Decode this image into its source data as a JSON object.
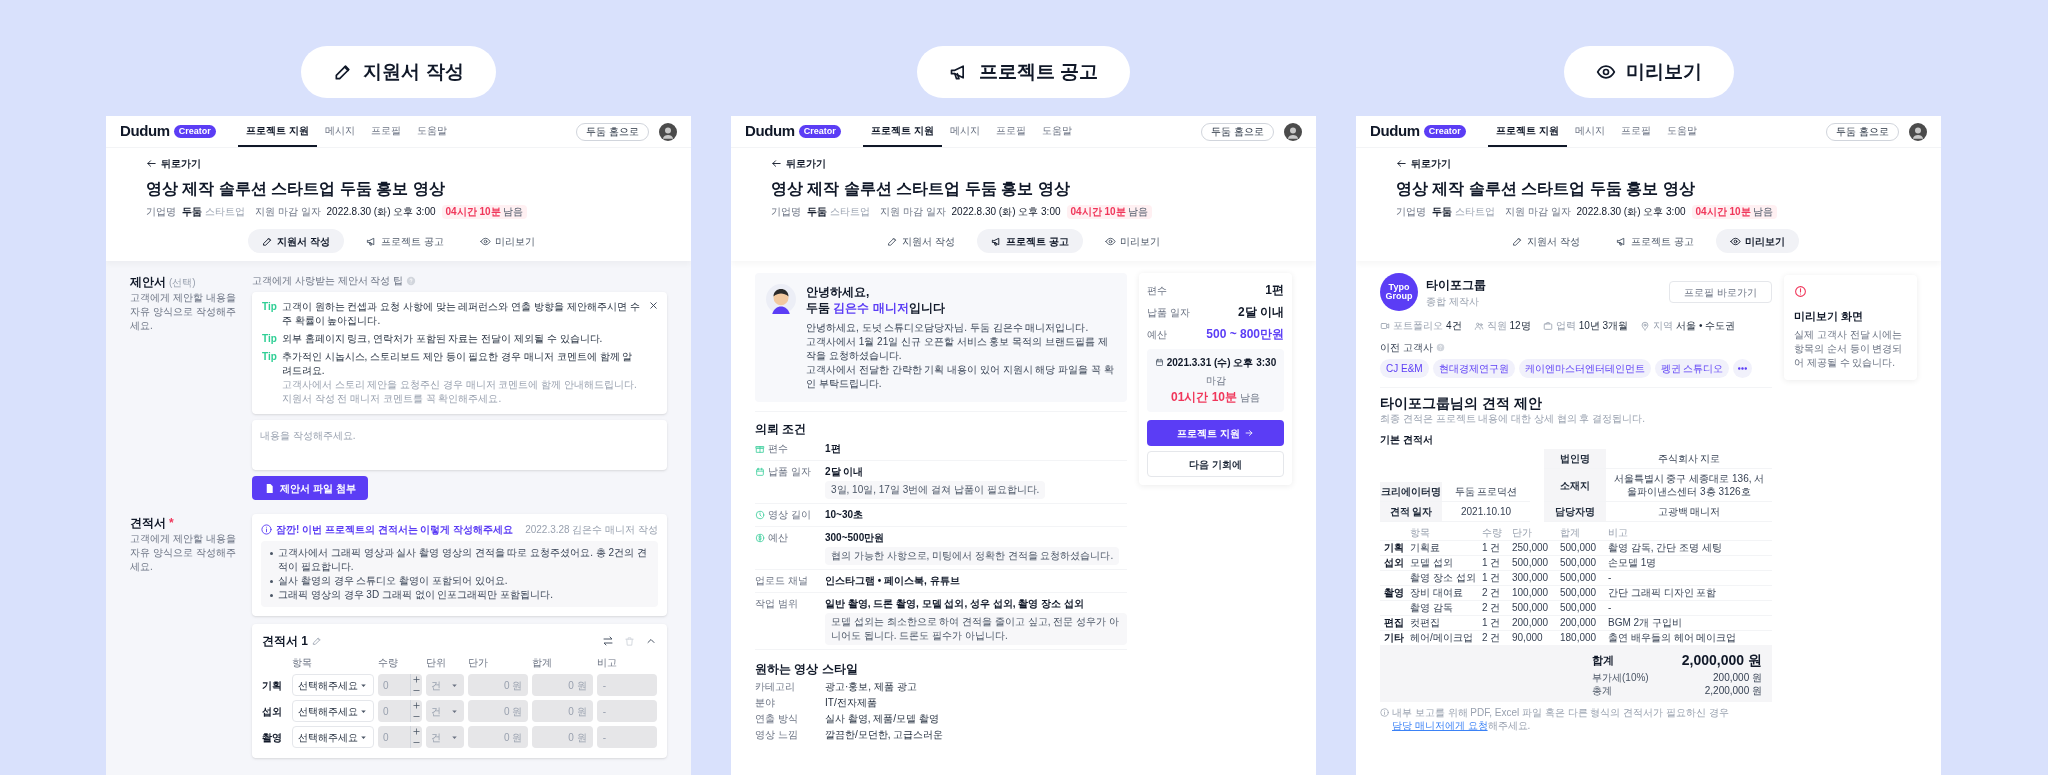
{
  "steps": [
    {
      "label": "지원서 작성"
    },
    {
      "label": "프로젝트 공고"
    },
    {
      "label": "미리보기"
    }
  ],
  "screens": [
    {
      "nav": {
        "logo": "Dudum",
        "badge": "Creator",
        "items": [
          {
            "label": "프로젝트 지원",
            "selected": true
          },
          {
            "label": "메시지",
            "selected": false
          },
          {
            "label": "프로필",
            "selected": false
          },
          {
            "label": "도움말",
            "selected": false
          }
        ],
        "home_button": "두둠 홈으로"
      },
      "back": "뒤로가기",
      "title": "영상 제작 솔루션 스타트업 두둠 홍보 영상",
      "meta": {
        "company_label": "기업명",
        "company": "두둠",
        "company_type": "스타트업",
        "deadline_label": "지원 마감 일자",
        "deadline": "2022.8.30 (화) 오후 3:00",
        "remaining": "04시간 10분",
        "remaining_suffix": "남음"
      },
      "tabs": [
        {
          "label": "지원서 작성",
          "selected": true
        },
        {
          "label": "프로젝트 공고",
          "selected": false
        },
        {
          "label": "미리보기",
          "selected": false
        }
      ],
      "body": {
        "kind": "application",
        "proposal": {
          "title": "제안서",
          "tag": "(선택)",
          "desc": [
            "고객에게 제안할 내용을",
            "자유 양식으로 작성해주세요."
          ],
          "tip_heading": "고객에게 사랑받는 제안서 작성 팁",
          "tips": [
            {
              "label": "Tip",
              "text": "고객이 원하는 컨셉과 요청 사항에 맞는 레퍼런스와 연출 방향을 제안해주시면 수주 확률이 높아집니다."
            },
            {
              "label": "Tip",
              "text": "외부 홈페이지 링크, 연락처가 포함된 자료는 전달이 제외될 수 있습니다."
            },
            {
              "label": "Tip",
              "text": "추가적인 시놉시스, 스토리보드 제안 등이 필요한 경우 매니저 코멘트에 함께 알려드려요.",
              "note": "고객사에서 스토리 제안을 요청주신 경우 매니저 코멘트에 함께 안내해드립니다. 지원서 작성 전 매니저 코멘트를 꼭 확인해주세요."
            }
          ],
          "placeholder": "내용을 작성해주세요.",
          "attach_button": "제안서 파일 첨부"
        },
        "estimate": {
          "title": "견적서",
          "required": "*",
          "desc": [
            "고객에게 제안할 내용을",
            "자유 양식으로 작성해주세요."
          ],
          "notice": {
            "title": "잠깐! 이번 프로젝트의 견적서는 이렇게 작성해주세요",
            "meta": "2022.3.28 김은수 매니저 작성",
            "bullets": [
              "고객사에서 그래픽 영상과 실사 촬영 영상의 견적을 따로 요청주셨어요. 총 2건의 견적이 필요합니다.",
              "실사 촬영의 경우 스튜디오 촬영이 포함되어 있어요.",
              "그래픽 영상의 경우 3D 그래픽 없이 인포그래픽만 포함됩니다."
            ]
          },
          "sheet": {
            "title": "견적서 1",
            "columns": [
              "항목",
              "수량",
              "단위",
              "단가",
              "합계",
              "비고"
            ],
            "rows": [
              {
                "category": "기획",
                "select": "선택해주세요",
                "qty": "0",
                "unit": "건",
                "price": "0 원",
                "total": "0 원",
                "note": "-"
              },
              {
                "category": "섭외",
                "select": "선택해주세요",
                "qty": "0",
                "unit": "건",
                "price": "0 원",
                "total": "0 원",
                "note": "-"
              },
              {
                "category": "촬영",
                "select": "선택해주세요",
                "qty": "0",
                "unit": "건",
                "price": "0 원",
                "total": "0 원",
                "note": "-"
              }
            ]
          }
        }
      }
    },
    {
      "nav": {
        "logo": "Dudum",
        "badge": "Creator",
        "items": [
          {
            "label": "프로젝트 지원",
            "selected": true
          },
          {
            "label": "메시지",
            "selected": false
          },
          {
            "label": "프로필",
            "selected": false
          },
          {
            "label": "도움말",
            "selected": false
          }
        ],
        "home_button": "두둠 홈으로"
      },
      "back": "뒤로가기",
      "title": "영상 제작 솔루션 스타트업 두둠 홍보 영상",
      "meta": {
        "company_label": "기업명",
        "company": "두둠",
        "company_type": "스타트업",
        "deadline_label": "지원 마감 일자",
        "deadline": "2022.8.30 (화) 오후 3:00",
        "remaining": "04시간 10분",
        "remaining_suffix": "남음"
      },
      "tabs": [
        {
          "label": "지원서 작성",
          "selected": false
        },
        {
          "label": "프로젝트 공고",
          "selected": true
        },
        {
          "label": "미리보기",
          "selected": false
        }
      ],
      "body": {
        "kind": "notice",
        "manager": {
          "greeting": "안녕하세요,",
          "intro_before": "두둠 ",
          "intro_name": "김은수 매니저",
          "intro_after": "입니다",
          "messages": [
            "안녕하세요, 도넛 스튜디오담당자님. 두둠 김은수 매니저입니다.",
            "고객사에서 1월 21일 신규 오픈할 서비스 홍보 목적의 브랜드필름 제작을 요청하셨습니다.",
            "고객사에서 전달한 간략한 기획 내용이 있어 지원시 해당 파일을 꼭 확인 부탁드립니다."
          ]
        },
        "conditions": {
          "title": "의뢰 조건",
          "rows": [
            {
              "label": "편수",
              "value": "1편"
            },
            {
              "label": "납품 일자",
              "value": "2달 이내",
              "note": "3일, 10일, 17일 3번에 걸쳐 납품이 필요합니다."
            },
            {
              "label": "영상 길이",
              "value": "10~30초"
            },
            {
              "label": "예산",
              "value": "300~500만원",
              "note": "협의 가능한 사항으로, 미팅에서 정확한 견적을 요청하셨습니다."
            },
            {
              "label": "업로드 채널",
              "value": "인스타그램 • 페이스북, 유튜브"
            },
            {
              "label": "작업 범위",
              "value": "일반 촬영, 드론 촬영, 모델 섭외, 성우 섭외, 촬영 장소 섭외",
              "note": "모델 섭외는 최소한으로 하여 견적을 줄이고 싶고, 전문 성우가 아니어도 됩니다. 드론도 필수가 아닙니다."
            }
          ]
        },
        "style": {
          "title": "원하는 영상 스타일",
          "rows": [
            {
              "label": "카테고리",
              "value": "광고·홍보, 제품 광고"
            },
            {
              "label": "분야",
              "value": "IT/전자제품"
            },
            {
              "label": "연출 방식",
              "value": "실사 촬영, 제품/모델 촬영"
            },
            {
              "label": "영상 느낌",
              "value": "깔끔한/모던한, 고급스러운"
            }
          ]
        },
        "summary": {
          "rows": [
            {
              "label": "편수",
              "value": "1편",
              "highlight": false
            },
            {
              "label": "납품 일자",
              "value": "2달 이내",
              "highlight": false
            },
            {
              "label": "예산",
              "value": "500 ~ 800만원",
              "highlight": true
            }
          ],
          "deadline": "2021.3.31 (수) 오후 3:30",
          "deadline_suffix": "마감",
          "remaining": "01시간 10분",
          "remaining_suffix": "남음",
          "apply_button": "프로젝트 지원",
          "later_button": "다음 기회에"
        }
      }
    },
    {
      "nav": {
        "logo": "Dudum",
        "badge": "Creator",
        "items": [
          {
            "label": "프로젝트 지원",
            "selected": true
          },
          {
            "label": "메시지",
            "selected": false
          },
          {
            "label": "프로필",
            "selected": false
          },
          {
            "label": "도움말",
            "selected": false
          }
        ],
        "home_button": "두둠 홈으로"
      },
      "back": "뒤로가기",
      "title": "영상 제작 솔루션 스타트업 두둠 홍보 영상",
      "meta": {
        "company_label": "기업명",
        "company": "두둠",
        "company_type": "스타트업",
        "deadline_label": "지원 마감 일자",
        "deadline": "2022.8.30 (화) 오후 3:00",
        "remaining": "04시간 10분",
        "remaining_suffix": "남음"
      },
      "tabs": [
        {
          "label": "지원서 작성",
          "selected": false
        },
        {
          "label": "프로젝트 공고",
          "selected": false
        },
        {
          "label": "미리보기",
          "selected": true
        }
      ],
      "body": {
        "kind": "preview",
        "company": {
          "logo": "Typo Group",
          "name": "타이포그룹",
          "type": "종합 제작사",
          "profile_button": "프로필 바로가기",
          "stats": [
            {
              "label": "포트폴리오",
              "value": "4건"
            },
            {
              "label": "직원",
              "value": "12명"
            },
            {
              "label": "업력",
              "value": "10년 3개월"
            },
            {
              "label": "지역",
              "value": "서울 • 수도권"
            }
          ],
          "clients_label": "이전 고객사",
          "clients": [
            "CJ E&M",
            "현대경제연구원",
            "케이엔마스터엔터테인먼트",
            "펭귄 스튜디오"
          ]
        },
        "preview_note": {
          "title": "미리보기 화면",
          "text": "실제 고객사 전달 시에는 항목의 순서 등이 변경되어 제공될 수 있습니다."
        },
        "quote": {
          "title": "타이포그룹님의 견적 제안",
          "subtitle": "최종 견적은 프로젝트 내용에 대한 상세 협의 후 결정됩니다.",
          "sheet_title": "기본 견적서",
          "left_info": [
            {
              "label": "크리에이터명",
              "value": "두둠 프로덕션"
            },
            {
              "label": "견적 일자",
              "value": "2021.10.10"
            }
          ],
          "right_info": [
            {
              "label": "법인명",
              "value": "주식회사 지로"
            },
            {
              "label": "소재지",
              "value": "서울특별시 중구 세종대로 136, 서울파이낸스센터 3층 3126호"
            },
            {
              "label": "담당자명",
              "value": "고광백 매니저"
            }
          ],
          "columns": [
            "항목",
            "수량",
            "단가",
            "합계",
            "비고"
          ],
          "rows": [
            {
              "category": "기획",
              "item": "기획료",
              "qty": "1 건",
              "price": "250,000",
              "total": "500,000",
              "note": "촬영 감독, 간단 조명 세팅"
            },
            {
              "category": "섭외",
              "item": "모델 섭외",
              "qty": "1 건",
              "price": "500,000",
              "total": "500,000",
              "note": "손모델 1명"
            },
            {
              "item": "촬영 장소 섭외",
              "qty": "1 건",
              "price": "300,000",
              "total": "500,000",
              "note": "-"
            },
            {
              "category": "촬영",
              "item": "장비 대여료",
              "qty": "2 건",
              "price": "100,000",
              "total": "500,000",
              "note": "간단 그래픽 디자인 포함"
            },
            {
              "item": "촬영 감독",
              "qty": "2 건",
              "price": "500,000",
              "total": "500,000",
              "note": "-"
            },
            {
              "category": "편집",
              "item": "컷편집",
              "qty": "1 건",
              "price": "200,000",
              "total": "200,000",
              "note": "BGM 2개 구입비"
            },
            {
              "category": "기타",
              "item": "헤어/메이크업",
              "qty": "2 건",
              "price": "90,000",
              "total": "180,000",
              "note": "출연 배우들의 헤어 메이크업"
            }
          ],
          "sum": {
            "label": "합계",
            "value": "2,000,000 원"
          },
          "vat": {
            "label": "부가세(10%)",
            "value": "200,000 원"
          },
          "grand": {
            "label": "총계",
            "value": "2,200,000 원"
          },
          "footnote_before": "내부 보고를 위해 PDF, Excel 파일 혹은 다른 형식의 견적서가 필요하신 경우 ",
          "footnote_link": "담당 매니저에게 요청",
          "footnote_after": "해주세요."
        }
      }
    }
  ]
}
